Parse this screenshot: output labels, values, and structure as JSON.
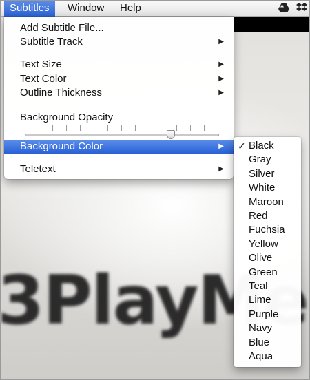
{
  "menubar": {
    "items": [
      {
        "label": "Subtitles",
        "active": true
      },
      {
        "label": "Window",
        "active": false
      },
      {
        "label": "Help",
        "active": false
      }
    ],
    "tray_icons": [
      "google-drive-icon",
      "dropbox-icon"
    ]
  },
  "video": {
    "logo_text": "3PlayMe"
  },
  "menu": {
    "items": [
      {
        "label": "Add Subtitle File...",
        "submenu": false
      },
      {
        "label": "Subtitle Track",
        "submenu": true
      },
      {
        "label": "Text Size",
        "submenu": true
      },
      {
        "label": "Text Color",
        "submenu": true
      },
      {
        "label": "Outline Thickness",
        "submenu": true
      },
      {
        "label": "Background Opacity",
        "submenu": false
      },
      {
        "label": "Background Color",
        "submenu": true,
        "highlighted": true
      },
      {
        "label": "Teletext",
        "submenu": true
      }
    ],
    "opacity_slider": {
      "value": 0.75,
      "ticks": 15
    }
  },
  "submenu": {
    "selected": "Black",
    "items": [
      "Black",
      "Gray",
      "Silver",
      "White",
      "Maroon",
      "Red",
      "Fuchsia",
      "Yellow",
      "Olive",
      "Green",
      "Teal",
      "Lime",
      "Purple",
      "Navy",
      "Blue",
      "Aqua"
    ]
  },
  "colors": {
    "highlight": "#2961d6",
    "check_mark": "✓"
  }
}
